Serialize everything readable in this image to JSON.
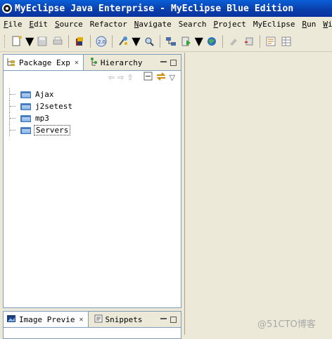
{
  "window": {
    "title": "MyEclipse Java Enterprise - MyEclipse Blue Edition"
  },
  "menu": [
    {
      "label": "File",
      "u": "F",
      "rest": "ile"
    },
    {
      "label": "Edit",
      "u": "E",
      "rest": "dit"
    },
    {
      "label": "Source",
      "u": "S",
      "rest": "ource"
    },
    {
      "label": "Refactor",
      "u": "",
      "rest": "Refactor"
    },
    {
      "label": "Navigate",
      "u": "N",
      "rest": "avigate"
    },
    {
      "label": "Search",
      "u": "",
      "rest": "Search"
    },
    {
      "label": "Project",
      "u": "P",
      "rest": "roject"
    },
    {
      "label": "MyEclipse",
      "u": "",
      "rest": "MyEclipse"
    },
    {
      "label": "Run",
      "u": "R",
      "rest": "un"
    },
    {
      "label": "Window",
      "u": "W",
      "rest": "indo"
    }
  ],
  "explorer": {
    "tabs": [
      {
        "label": "Package Exp",
        "icon": "package-explorer-icon",
        "active": true
      },
      {
        "label": "Hierarchy",
        "icon": "hierarchy-icon",
        "active": false
      }
    ],
    "items": [
      {
        "label": "Ajax",
        "icon": "folder-icon"
      },
      {
        "label": "j2setest",
        "icon": "folder-icon"
      },
      {
        "label": "mp3",
        "icon": "folder-icon"
      },
      {
        "label": "Servers",
        "icon": "folder-icon",
        "selected": true
      }
    ]
  },
  "bottom_panel": {
    "tabs": [
      {
        "label": "Image Previe",
        "icon": "image-preview-icon",
        "active": true
      },
      {
        "label": "Snippets",
        "icon": "snippets-icon",
        "active": false
      }
    ]
  },
  "watermark": "@51CTO博客",
  "colors": {
    "titlebar": "#0a3da8",
    "chrome": "#ece9d8",
    "folder": "#7fb0e6",
    "panel_border": "#7f9db9"
  }
}
